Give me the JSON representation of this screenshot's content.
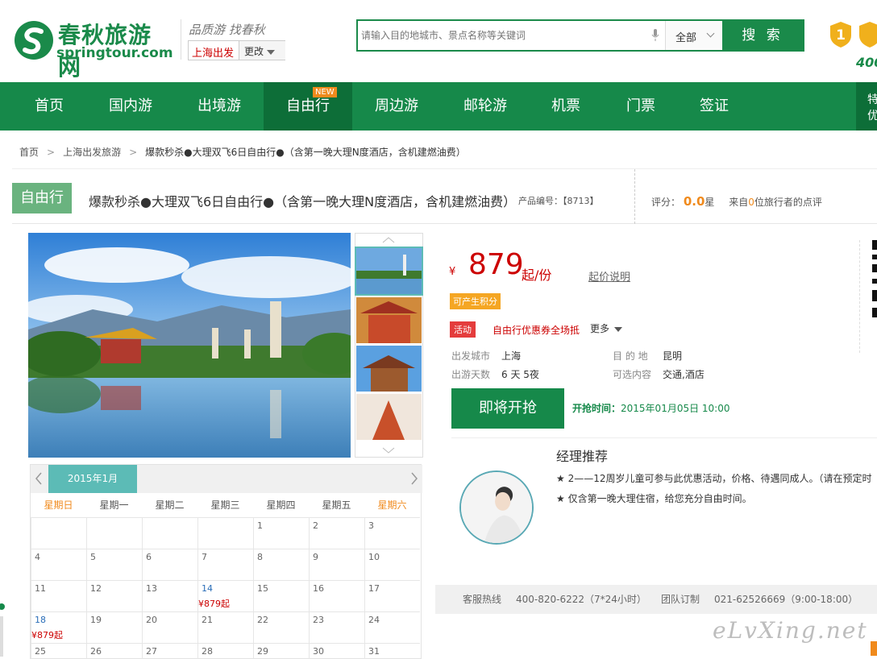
{
  "header": {
    "logo_cn": "春秋旅游网",
    "logo_en": "springtour.com",
    "slogan": "品质游 找春秋",
    "city": "上海出发",
    "city_change": "更改",
    "search_placeholder": "请输入目的地城市、景点名称等关键词",
    "search_category": "全部",
    "search_button": "搜 索",
    "hotline_partial": "400"
  },
  "nav": {
    "items": [
      "首页",
      "国内游",
      "出境游",
      "自由行",
      "周边游",
      "邮轮游",
      "机票",
      "门票",
      "签证"
    ],
    "new_tag": "NEW",
    "right_label": "特\n优"
  },
  "breadcrumb": [
    "首页",
    "上海出发旅游",
    "爆款秒杀●大理双飞6日自由行●（含第一晚大理N度酒店，含机建燃油费）"
  ],
  "product": {
    "tag": "自由行",
    "title": "爆款秒杀●大理双飞6日自由行●（含第一晚大理N度酒店，含机建燃油费）",
    "product_no": "产品编号：【8713】",
    "rating_label": "评分：",
    "rating_value": "0.0",
    "rating_unit": "星",
    "reviews_prefix": "来自",
    "reviews_count": "0",
    "reviews_suffix": "位旅行者的点评"
  },
  "price": {
    "symbol": "¥",
    "value": "879",
    "unit": "起/份",
    "note": "起价说明",
    "points_tag": "可产生积分",
    "promo_tag": "活动",
    "promo_text": "自由行优惠券全场抵",
    "promo_more": "更多"
  },
  "info": {
    "depart_label": "出发城市",
    "depart_value": "上海",
    "dest_label": "目 的 地",
    "dest_value": "昆明",
    "days_label": "出游天数",
    "days_value": "6 天 5夜",
    "content_label": "可选内容",
    "content_value": "交通,酒店"
  },
  "buy": {
    "button": "即将开抢",
    "time_label": "开抢时间：",
    "time_value": "2015年01月05日 10:00"
  },
  "manager": {
    "title": "经理推荐",
    "lines": [
      "★ 2——12周岁儿童可参与此优惠活动，价格、待遇同成人。（请在预定时",
      "★ 仅含第一晚大理住宿，给您充分自由时间。"
    ]
  },
  "service": {
    "hotline_label": "客服热线",
    "hotline": "400-820-6222（7*24小时）",
    "group_label": "团队订制",
    "group": "021-62526669（9:00-18:00）"
  },
  "watermark": "eLvXing.net",
  "calendar": {
    "month": "2015年1月",
    "weekdays": [
      "星期日",
      "星期一",
      "星期二",
      "星期三",
      "星期四",
      "星期五",
      "星期六"
    ],
    "rows": [
      [
        "",
        "",
        "",
        "",
        "1",
        "2",
        "3"
      ],
      [
        "4",
        "5",
        "6",
        "7",
        "8",
        "9",
        "10"
      ],
      [
        "11",
        "12",
        "13",
        "14",
        "15",
        "16",
        "17"
      ],
      [
        "18",
        "19",
        "20",
        "21",
        "22",
        "23",
        "24"
      ],
      [
        "25",
        "26",
        "27",
        "28",
        "29",
        "30",
        "31"
      ]
    ],
    "price_label": "¥879起",
    "priced_days": [
      "14",
      "18"
    ]
  },
  "colors": {
    "brand_green": "#16894a",
    "dark_green": "#0d6e38",
    "price_red": "#cc0000",
    "accent_orange": "#f08a1c",
    "calendar_teal": "#5cbbb6"
  }
}
